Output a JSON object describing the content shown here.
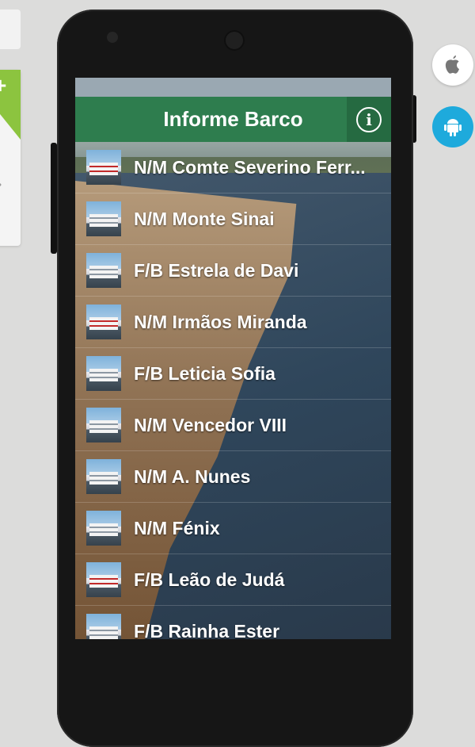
{
  "header": {
    "title": "Informe Barco",
    "info_icon": "info-icon",
    "accent": "#2e7d4e"
  },
  "boats": [
    {
      "name": "N/M Comte Severino Ferr...",
      "thumb": "red"
    },
    {
      "name": "N/M Monte Sinai",
      "thumb": ""
    },
    {
      "name": "F/B Estrela de Davi",
      "thumb": ""
    },
    {
      "name": "N/M Irmãos Miranda",
      "thumb": "red"
    },
    {
      "name": "F/B Leticia Sofia",
      "thumb": ""
    },
    {
      "name": "N/M Vencedor VIII",
      "thumb": ""
    },
    {
      "name": "N/M A. Nunes",
      "thumb": ""
    },
    {
      "name": "N/M Fénix",
      "thumb": ""
    },
    {
      "name": "F/B Leão de Judá",
      "thumb": "red"
    },
    {
      "name": "F/B Rainha Ester",
      "thumb": ""
    }
  ],
  "platforms": {
    "apple_icon": "apple-icon",
    "android_icon": "android-icon",
    "android_color": "#1eaadc"
  }
}
